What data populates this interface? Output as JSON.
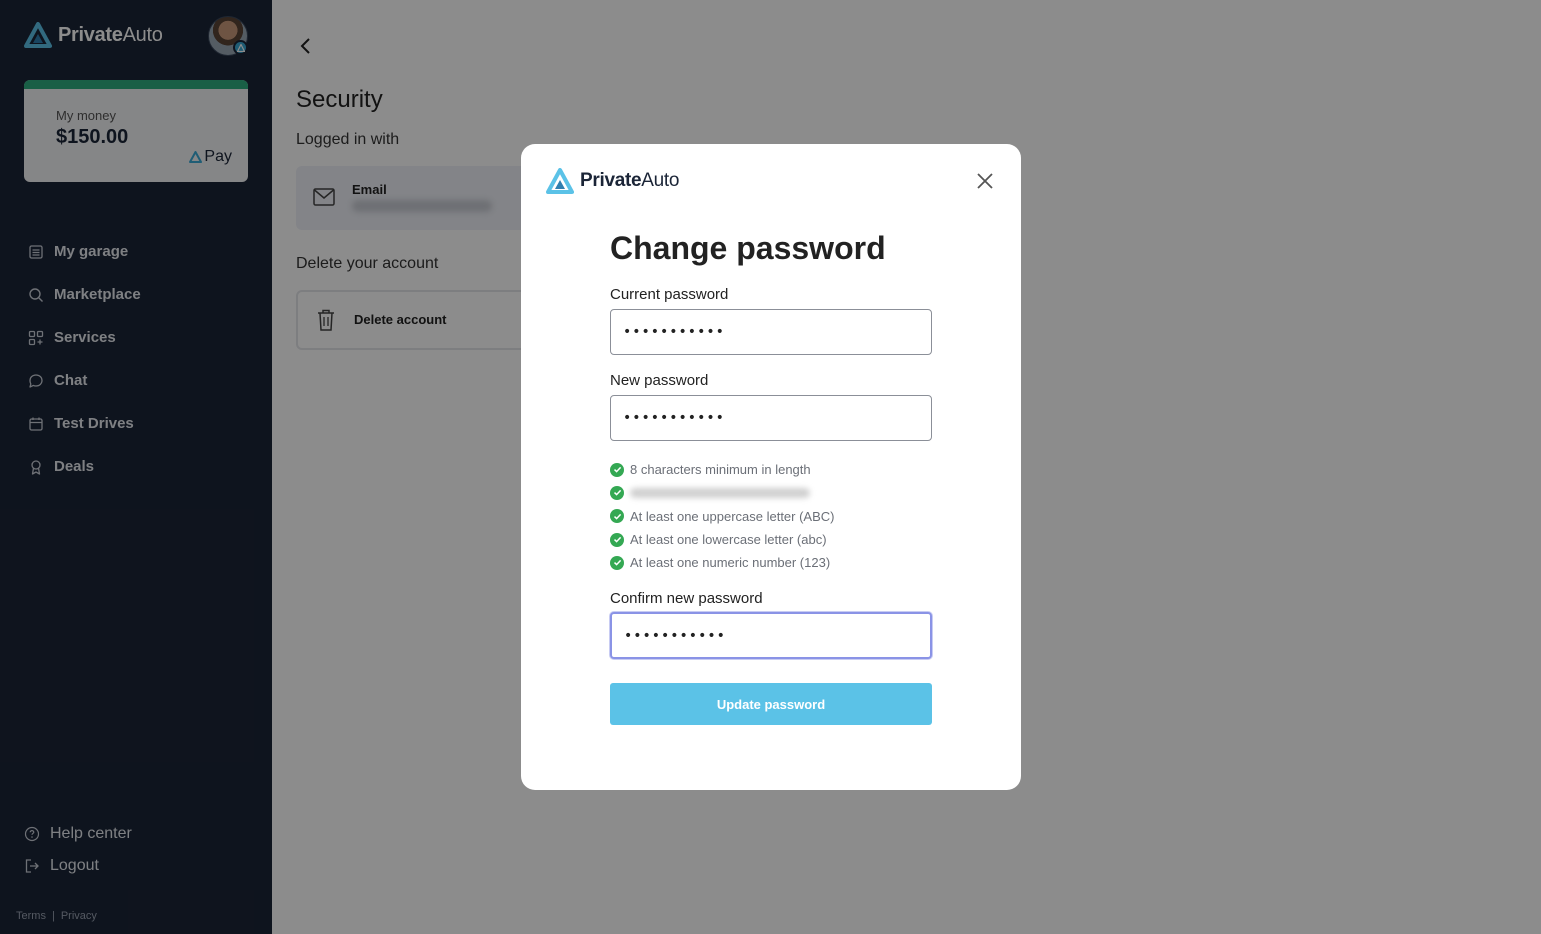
{
  "sidebar": {
    "logo_primary": "Private",
    "logo_secondary": "Auto",
    "money": {
      "label": "My money",
      "amount": "$150.00",
      "brand": "Pay"
    },
    "nav": [
      {
        "label": "My garage",
        "icon": "garage-icon"
      },
      {
        "label": "Marketplace",
        "icon": "search-icon"
      },
      {
        "label": "Services",
        "icon": "grid-icon"
      },
      {
        "label": "Chat",
        "icon": "chat-icon"
      },
      {
        "label": "Test Drives",
        "icon": "calendar-icon"
      },
      {
        "label": "Deals",
        "icon": "award-icon"
      }
    ],
    "bottom": [
      {
        "label": "Help center",
        "icon": "help-icon"
      },
      {
        "label": "Logout",
        "icon": "logout-icon"
      }
    ],
    "legal": {
      "terms": "Terms",
      "separator": "|",
      "privacy": "Privacy"
    }
  },
  "main": {
    "title": "Security",
    "logged_in_label": "Logged in with",
    "email_card_title": "Email",
    "delete_section_label": "Delete your account",
    "delete_button_label": "Delete account"
  },
  "modal": {
    "logo_primary": "Private",
    "logo_secondary": "Auto",
    "title": "Change password",
    "current_label": "Current password",
    "current_value": "•••••••••••",
    "new_label": "New password",
    "new_value": "•••••••••••",
    "requirements": [
      {
        "text": "8 characters minimum in length",
        "met": true
      },
      {
        "text": "",
        "met": true
      },
      {
        "text": "At least one uppercase letter (ABC)",
        "met": true
      },
      {
        "text": "At least one lowercase letter (abc)",
        "met": true
      },
      {
        "text": "At least one numeric number (123)",
        "met": true
      }
    ],
    "confirm_label": "Confirm new password",
    "confirm_value": "•••••••••••",
    "submit_label": "Update password"
  },
  "colors": {
    "sidebar_bg": "#1b2537",
    "accent_green": "#2fae80",
    "button_blue": "#5bc2e7",
    "check_green": "#34a853"
  }
}
